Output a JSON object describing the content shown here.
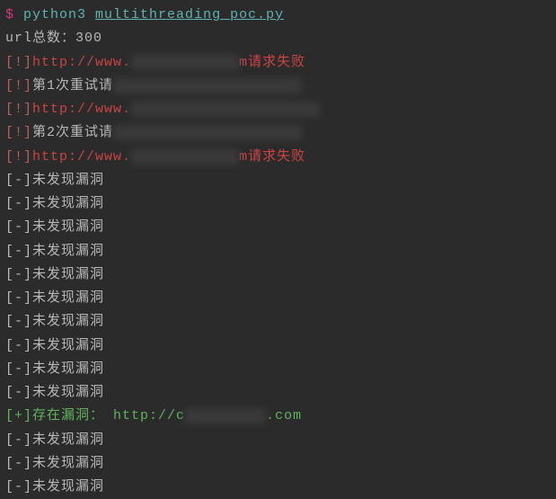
{
  "prompt": {
    "symbol": "$",
    "command": "python3 ",
    "script": "multithreading_poc.py"
  },
  "header": {
    "url_count_label": "url总数：",
    "url_count_value": "300"
  },
  "lines": [
    {
      "type": "error",
      "bracket": "[!]",
      "prefix": "http://www.",
      "redacted": "xxxxxxxxxxxx",
      "suffix": "m请求失败"
    },
    {
      "type": "retry",
      "bracket": "[!]",
      "text": "第1次重试请",
      "redacted": "xxxxxxxxxxxxxxxxxxxxx"
    },
    {
      "type": "error",
      "bracket": "[!]",
      "prefix": "http://www.",
      "redacted": "xxxxxxxxxxxxxxxxxxxxm"
    },
    {
      "type": "retry",
      "bracket": "[!]",
      "text": "第2次重试请",
      "redacted": "xxxxxxxxxxxxxxxxxxxxx"
    },
    {
      "type": "error",
      "bracket": "[!]",
      "prefix": "http://www.",
      "redacted": "xxxxxxxxxxxx",
      "suffix": "m请求失败"
    },
    {
      "type": "novuln",
      "bracket": "[-]",
      "text": "未发现漏洞"
    },
    {
      "type": "novuln",
      "bracket": "[-]",
      "text": "未发现漏洞"
    },
    {
      "type": "novuln",
      "bracket": "[-]",
      "text": "未发现漏洞"
    },
    {
      "type": "novuln",
      "bracket": "[-]",
      "text": "未发现漏洞"
    },
    {
      "type": "novuln",
      "bracket": "[-]",
      "text": "未发现漏洞"
    },
    {
      "type": "novuln",
      "bracket": "[-]",
      "text": "未发现漏洞"
    },
    {
      "type": "novuln",
      "bracket": "[-]",
      "text": "未发现漏洞"
    },
    {
      "type": "novuln",
      "bracket": "[-]",
      "text": "未发现漏洞"
    },
    {
      "type": "novuln",
      "bracket": "[-]",
      "text": "未发现漏洞"
    },
    {
      "type": "novuln",
      "bracket": "[-]",
      "text": "未发现漏洞"
    },
    {
      "type": "vuln",
      "bracket": "[+]",
      "text": "存在漏洞：",
      "url_prefix": "http://c",
      "redacted": "xxxxxxxxx",
      "url_suffix": ".com"
    },
    {
      "type": "novuln",
      "bracket": "[-]",
      "text": "未发现漏洞"
    },
    {
      "type": "novuln",
      "bracket": "[-]",
      "text": "未发现漏洞"
    },
    {
      "type": "novuln",
      "bracket": "[-]",
      "text": "未发现漏洞"
    }
  ]
}
